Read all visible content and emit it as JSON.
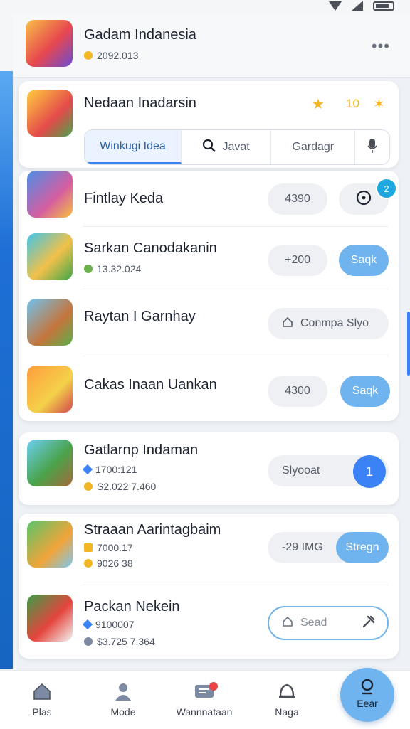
{
  "header": {
    "title": "Gadam Indanesia",
    "subtitle": "2092.013",
    "more_label": "•••"
  },
  "featured": {
    "title": "Nedaan Inadarsin",
    "icon_a": "★",
    "icon_b": "10",
    "icon_c": "✶",
    "search": {
      "tab_active": "Winkugi Idea",
      "query": "Javat",
      "tab_right": "Gardagr"
    }
  },
  "list": [
    {
      "title": "Fintlay Keda",
      "pill": "4390",
      "badge": "2",
      "action_icon": "target-icon"
    },
    {
      "title": "Sarkan Canodakanin",
      "sub": "13.32.024",
      "pill": "+200",
      "action": "Saqk"
    },
    {
      "title": "Raytan I Garnhay",
      "wide_pill": "Conmpa Slyo"
    },
    {
      "title": "Cakas Inaan Uankan",
      "pill": "4300",
      "action": "Saqk"
    },
    {
      "title": "Gatlarnp Indaman",
      "sub1": "1700:121",
      "sub2": "S2.022 7.460",
      "pill": "Slyooat",
      "action": "1"
    },
    {
      "title": "Straaan Aarintagbaim",
      "sub1": "7000.17",
      "sub2": "9026 38",
      "pill": "-29 IMG",
      "action": "Stregn"
    },
    {
      "title": "Packan Nekein",
      "sub1": "9100007",
      "sub2": "$3.725 7.364",
      "outline_action": "Sead"
    }
  ],
  "nav": [
    {
      "label": "Plas"
    },
    {
      "label": "Mode"
    },
    {
      "label": "Wannnataan"
    },
    {
      "label": "Naga"
    },
    {
      "label": "Eear"
    }
  ],
  "colors": {
    "accent": "#3b82f6",
    "pill_blue": "#6fb4ee",
    "rail": "#1e6fd6"
  }
}
